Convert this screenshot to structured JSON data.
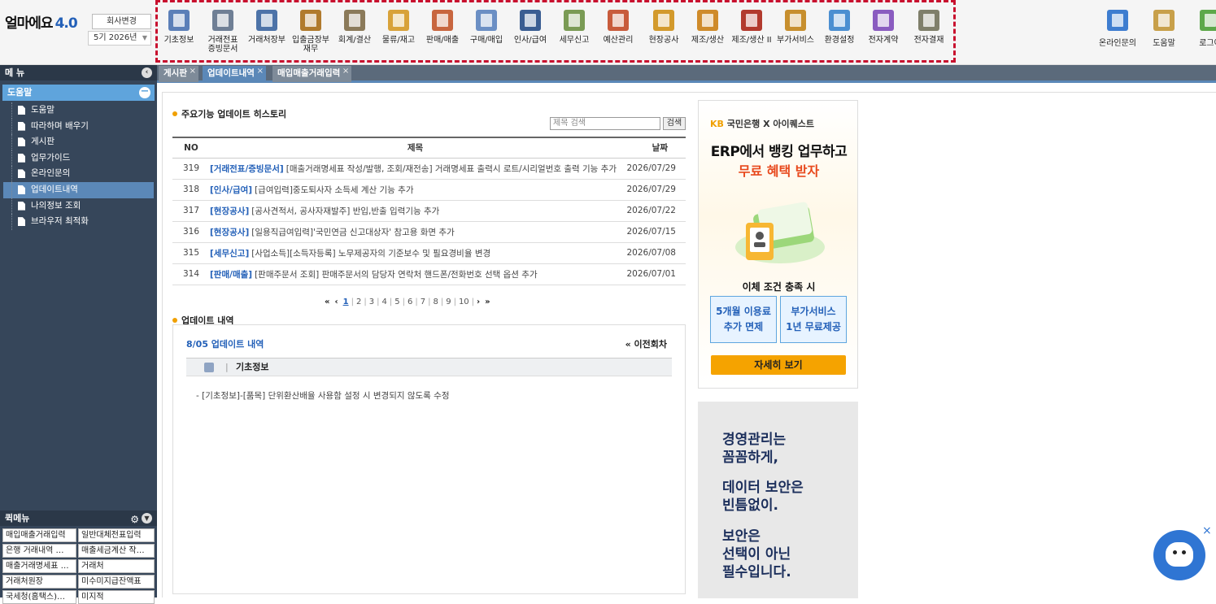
{
  "app": {
    "logo_text": "얼마에요",
    "logo_version": "4.0",
    "company_button": "회사변경",
    "period": "5기 2026년"
  },
  "top_menu": [
    {
      "label": "기초정보",
      "icon": "basic-info-icon",
      "color": "#5b7fb8"
    },
    {
      "label": "거래전표\n증빙문서",
      "icon": "voucher-icon",
      "color": "#6f7f95"
    },
    {
      "label": "거래처장부",
      "icon": "ledger-icon",
      "color": "#4d73a8"
    },
    {
      "label": "입출금장부\n재무",
      "icon": "cash-ledger-icon",
      "color": "#b07a2d"
    },
    {
      "label": "회계/결산",
      "icon": "accounting-icon",
      "color": "#8b7a5a"
    },
    {
      "label": "물류/재고",
      "icon": "logistics-icon",
      "color": "#d8a23a"
    },
    {
      "label": "판매/매출",
      "icon": "sales-icon",
      "color": "#c8663f"
    },
    {
      "label": "구매/매입",
      "icon": "purchase-icon",
      "color": "#6b8fc4"
    },
    {
      "label": "인사/급여",
      "icon": "hr-icon",
      "color": "#3a5d92"
    },
    {
      "label": "세무신고",
      "icon": "tax-icon",
      "color": "#7a9b55"
    },
    {
      "label": "예산관리",
      "icon": "budget-icon",
      "color": "#c85b3b"
    },
    {
      "label": "현장공사",
      "icon": "construction-icon",
      "color": "#d39a2c"
    },
    {
      "label": "제조/생산",
      "icon": "manufacturing-icon",
      "color": "#cf8b2a"
    },
    {
      "label": "제조/생산 II",
      "icon": "factory-icon",
      "color": "#b23a2e"
    },
    {
      "label": "부가서비스",
      "icon": "service-icon",
      "color": "#c78f2e"
    },
    {
      "label": "환경설정",
      "icon": "settings-icon",
      "color": "#4b8fd1"
    },
    {
      "label": "전자계약",
      "icon": "e-contract-icon",
      "color": "#8a5cc0"
    },
    {
      "label": "전자결재",
      "icon": "e-approval-icon",
      "color": "#7f7f6a"
    }
  ],
  "right_menu": [
    {
      "label": "온라인문의",
      "icon": "online-inquiry-icon",
      "color": "#3e7dd0"
    },
    {
      "label": "도움말",
      "icon": "help-icon",
      "color": "#c8a04a"
    },
    {
      "label": "로그아",
      "icon": "logout-icon",
      "color": "#5da84a"
    }
  ],
  "sidebar": {
    "title": "메 뉴",
    "section": "도움말",
    "items": [
      "도움말",
      "따라하며 배우기",
      "게시판",
      "업무가이드",
      "온라인문의",
      "업데이트내역",
      "나의정보 조회",
      "브라우저 최적화"
    ],
    "active": "업데이트내역"
  },
  "quick_menu": {
    "title": "퀵메뉴",
    "items": [
      "매입매출거래입력",
      "일반대체전표입력",
      "은행 거래내역 …",
      "매출세금계산 작…",
      "매출거래명세표 …",
      "거래처",
      "거래처원장",
      "미수미지급잔액표",
      "국세청(홈택스)…",
      "미지적"
    ]
  },
  "tabs": [
    {
      "label": "게시판",
      "active": false
    },
    {
      "label": "업데이트내역",
      "active": true
    },
    {
      "label": "매입매출거래입력",
      "active": false
    }
  ],
  "history": {
    "title": "주요기능 업데이트 히스토리",
    "search_placeholder": "제목 검색",
    "search_button": "검색",
    "columns": {
      "no": "NO",
      "title": "제목",
      "date": "날짜"
    },
    "rows": [
      {
        "no": "319",
        "cat": "[거래전표/증빙문서]",
        "text": "[매출거래명세표 작성/발행, 조회/재전송] 거래명세표 출력시 로트/시리얼번호 출력 기능 추가",
        "date": "2026/07/29"
      },
      {
        "no": "318",
        "cat": "[인사/급여]",
        "text": "[급여입력]중도퇴사자 소득세 계산 기능 추가",
        "date": "2026/07/29"
      },
      {
        "no": "317",
        "cat": "[현장공사]",
        "text": "[공사견적서, 공사자재발주] 반입,반출 입력기능 추가",
        "date": "2026/07/22"
      },
      {
        "no": "316",
        "cat": "[현장공사]",
        "text": "[일용직급여입력]'국민연금 신고대상자' 참고용 화면 추가",
        "date": "2026/07/15"
      },
      {
        "no": "315",
        "cat": "[세무신고]",
        "text": "[사업소득][소득자등록] 노무제공자의 기준보수 및 필요경비율 변경",
        "date": "2026/07/08"
      },
      {
        "no": "314",
        "cat": "[판매/매출]",
        "text": "[판매주문서 조회] 판매주문서의 담당자 연락처 핸드폰/전화번호 선택 옵션 추가",
        "date": "2026/07/01"
      }
    ],
    "pager": {
      "first": "«",
      "prev": "‹",
      "pages": [
        "1",
        "2",
        "3",
        "4",
        "5",
        "6",
        "7",
        "8",
        "9",
        "10"
      ],
      "current": "1",
      "next": "›",
      "last": "»"
    }
  },
  "update": {
    "title": "업데이트 내역",
    "date_title": "8/05 업데이트 내역",
    "prev": "« 이전회차",
    "category": "기초정보",
    "desc": "- [기초정보]-[품목] 단위환산배율 사용함 설정 시 변경되지 않도록 수정"
  },
  "ad1": {
    "brand_kb": "KB",
    "brand_kb_text": "국민은행",
    "brand_x": "X",
    "brand_partner": "아이퀘스트",
    "headline": "ERP에서 뱅킹 업무하고",
    "subheadline": "무료 혜택 받자",
    "condition": "이체 조건 충족 시",
    "box1": "5개월 이용료\n추가 면제",
    "box2": "부가서비스\n1년 무료제공",
    "cta": "자세히 보기"
  },
  "ad2": {
    "lines": [
      "경영관리는\n꼼꼼하게,",
      "데이터 보안은\n빈틈없이.",
      "보안은\n선택이 아닌\n필수입니다."
    ]
  },
  "chatbot": {
    "close": "×"
  }
}
